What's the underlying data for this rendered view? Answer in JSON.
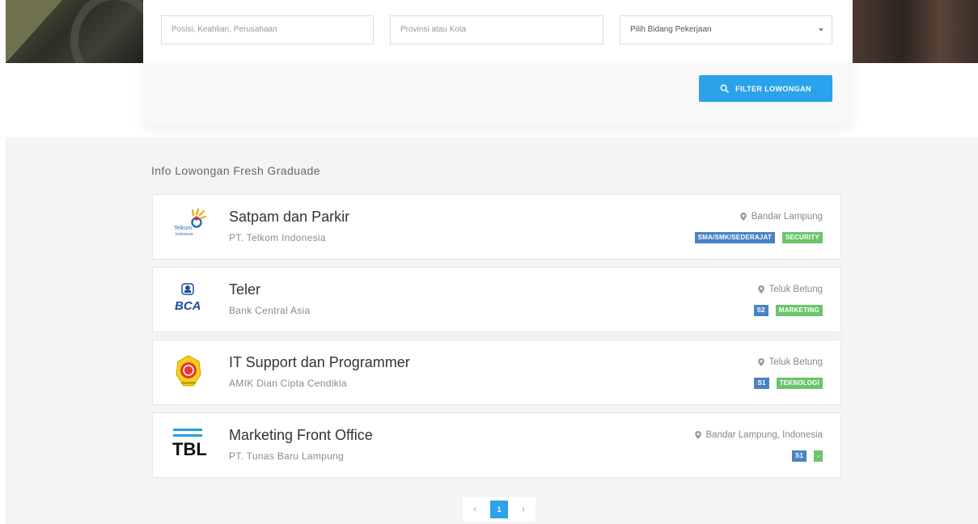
{
  "search": {
    "keyword_placeholder": "Posisi, Keahlian, Perusahaan",
    "location_placeholder": "Provinsi atau Kota",
    "category_selected": "Pilih Bidang Pekerjaan",
    "filter_button": "FILTER LOWONGAN"
  },
  "section": {
    "title": "Info Lowongan Fresh Graduade"
  },
  "jobs": [
    {
      "title": "Satpam dan Parkir",
      "company": "PT. Telkom Indonesia",
      "location": "Bandar Lampung",
      "education": "SMA/SMK/SEDERAJAT",
      "category": "SECURITY",
      "logo": "telkom-indonesia-logo",
      "logo_text": "Telkom Indonesia"
    },
    {
      "title": "Teler",
      "company": "Bank Central Asia",
      "location": "Teluk Betung",
      "education": "S2",
      "category": "MARKETING",
      "logo": "bca-logo",
      "logo_text": "BCA"
    },
    {
      "title": "IT Support dan Programmer",
      "company": "AMIK Dian Cipta Cendikia",
      "location": "Teluk Betung",
      "education": "S1",
      "category": "TEKNOLOGI",
      "logo": "amik-dcc-logo"
    },
    {
      "title": "Marketing Front Office",
      "company": "PT. Tunas Baru Lampung",
      "location": "Bandar Lampung, Indonesia",
      "education": "S1",
      "category": "-",
      "logo": "tbl-logo",
      "logo_text": "TBL"
    }
  ],
  "pagination": {
    "prev": "‹",
    "current": "1",
    "next": "›"
  },
  "colors": {
    "accent": "#2aa3ea",
    "education_tag": "#4a83c4",
    "category_tag": "#6bc56b"
  }
}
